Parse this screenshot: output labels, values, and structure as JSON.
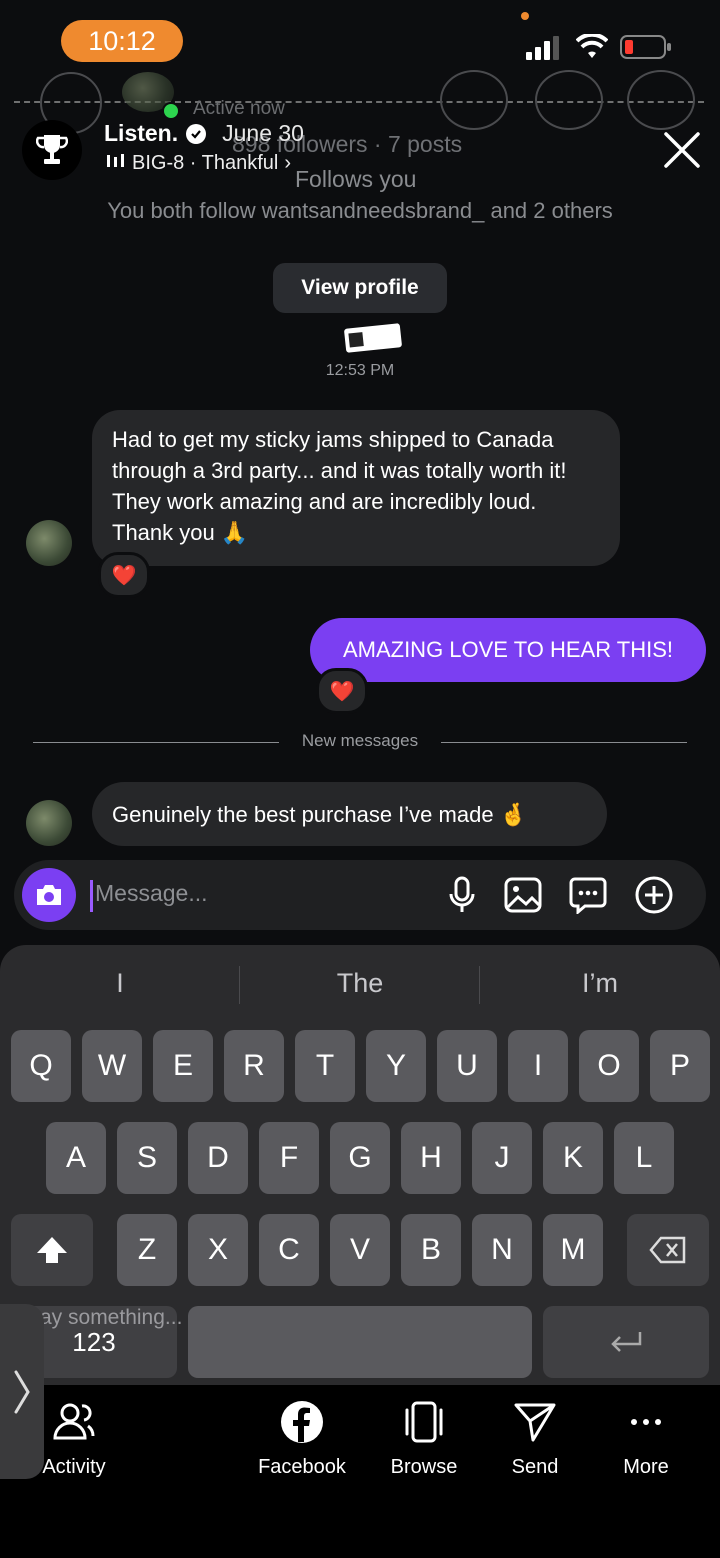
{
  "status_bar": {
    "time": "10:12"
  },
  "story_header": {
    "title": "Listen.",
    "date": "June 30",
    "music": "BIG-8 · Thankful"
  },
  "dm_header": {
    "active_status": "Active now",
    "followers": "898 followers · 7 posts",
    "follows_you": "Follows you",
    "mutuals": "You both follow wantsandneedsbrand_ and 2 others",
    "view_profile": "View profile"
  },
  "chat": {
    "timestamp": "12:53 PM",
    "msg1": "Had to get my sticky jams shipped to Canada through a 3rd party... and it was totally worth it! They work amazing and are incredibly loud. Thank you 🙏",
    "msg1_reaction": "❤️",
    "msg2": "AMAZING LOVE TO HEAR THIS!",
    "msg2_reaction": "❤️",
    "new_messages_label": "New messages",
    "msg3": "Genuinely the best purchase I’ve made 🤞"
  },
  "composer": {
    "placeholder": "Message..."
  },
  "keyboard": {
    "suggestions": [
      "I",
      "The",
      "I’m"
    ],
    "row1": [
      "Q",
      "W",
      "E",
      "R",
      "T",
      "Y",
      "U",
      "I",
      "O",
      "P"
    ],
    "row2": [
      "A",
      "S",
      "D",
      "F",
      "G",
      "H",
      "J",
      "K",
      "L"
    ],
    "row3": [
      "Z",
      "X",
      "C",
      "V",
      "B",
      "N",
      "M"
    ],
    "numbers_key": "123",
    "faded_text": "ay something..."
  },
  "bottom_nav": {
    "activity": "Activity",
    "facebook": "Facebook",
    "browse": "Browse",
    "send": "Send",
    "more": "More"
  }
}
